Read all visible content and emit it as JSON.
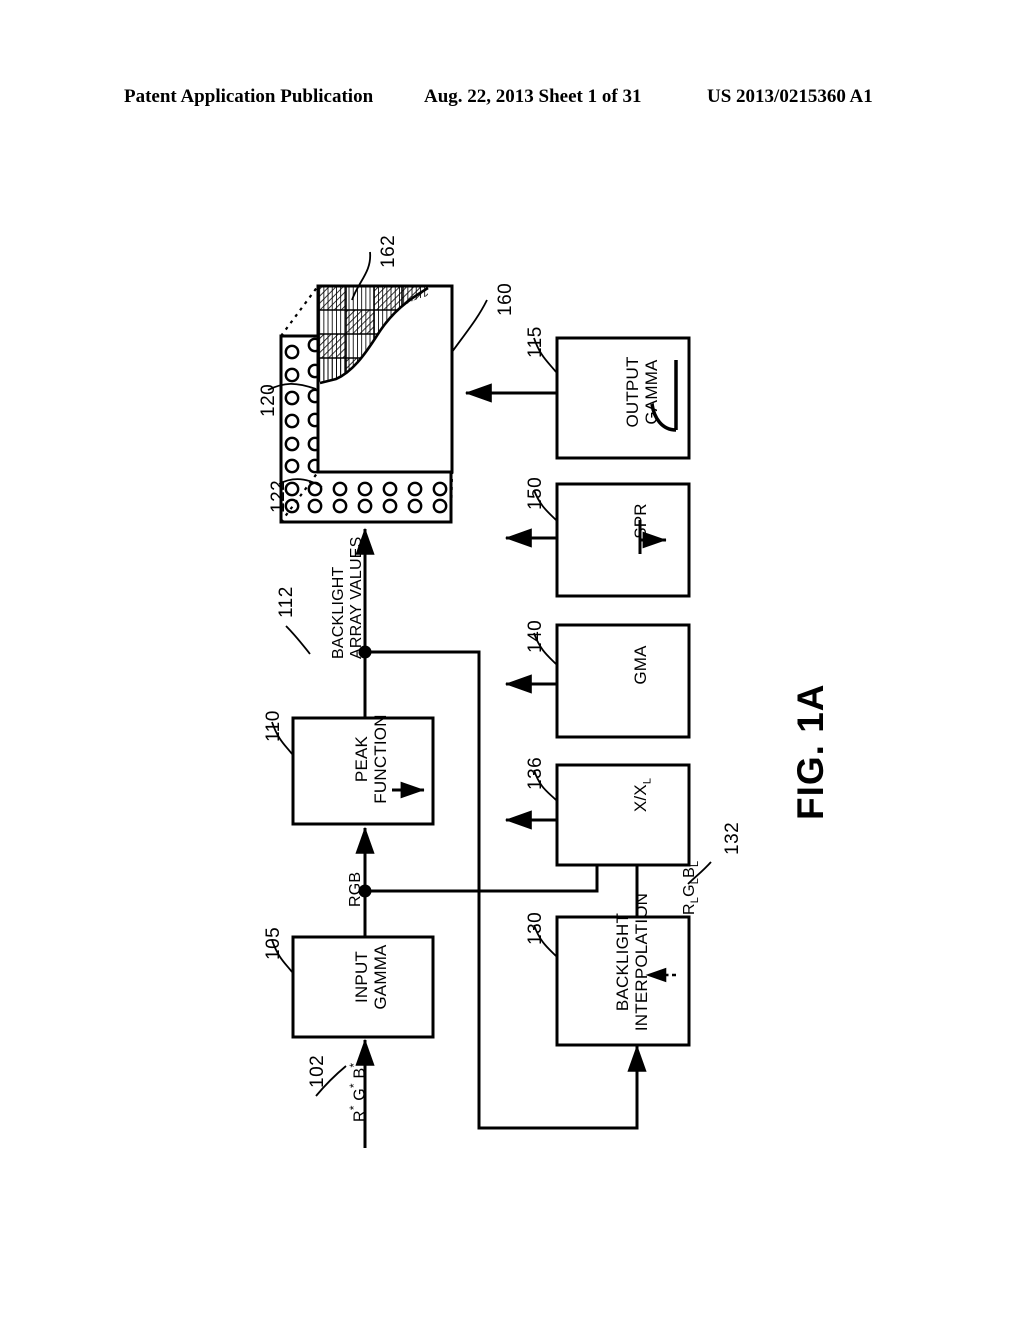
{
  "header": {
    "publication": "Patent Application Publication",
    "date_sheet": "Aug. 22, 2013  Sheet 1 of 31",
    "patent_number": "US 2013/0215360 A1"
  },
  "figure": {
    "caption": "FIG. 1A"
  },
  "blocks": [
    {
      "id": "input-gamma",
      "ref": "105",
      "label_lines": [
        "INPUT",
        "GAMMA"
      ],
      "icon": "none"
    },
    {
      "id": "peak-function",
      "ref": "110",
      "label_lines": [
        "PEAK",
        "FUNCTION"
      ],
      "icon": "solid-arrow-icon"
    },
    {
      "id": "output-gamma",
      "ref": "115",
      "label_lines": [
        "OUTPUT",
        "GAMMA"
      ],
      "icon": "gamma-curve-icon"
    },
    {
      "id": "backlight-interpolation",
      "ref": "130",
      "label_lines": [
        "BACKLIGHT",
        "INTERPOLATION"
      ],
      "icon": "dashed-arrow-icon"
    },
    {
      "id": "x-over-xl",
      "ref": "136",
      "label_lines": [
        "X/X",
        "L"
      ],
      "label_text": "X/XL",
      "icon": "none"
    },
    {
      "id": "gma",
      "ref": "140",
      "label_lines": [
        "GMA"
      ],
      "icon": "none"
    },
    {
      "id": "spr",
      "ref": "150",
      "label_lines": [
        "SPR"
      ],
      "icon": "solid-arrow-icon"
    }
  ],
  "signals": [
    {
      "id": "input-signal",
      "ref": "102",
      "label": "R* G* B*"
    },
    {
      "id": "rgb-signal",
      "ref": "",
      "label": "RGB"
    },
    {
      "id": "backlight-array-values",
      "ref": "112",
      "label": "BACKLIGHT ARRAY VALUES"
    },
    {
      "id": "backlight-levels",
      "ref": "132",
      "label": "RLGLBL"
    }
  ],
  "display": {
    "panel_ref": "160",
    "highlight_region_ref": "162",
    "backlight_array_ref": "120",
    "led_element_ref": "122"
  },
  "colors": {
    "ink": "#000000",
    "paper": "#ffffff"
  }
}
